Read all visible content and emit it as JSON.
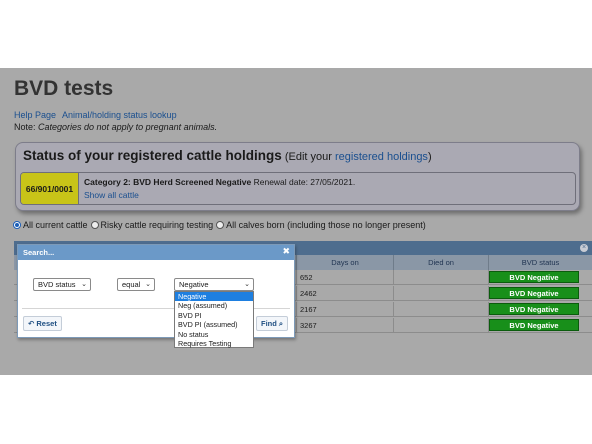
{
  "page": {
    "title": "BVD tests",
    "links": [
      "Help Page",
      "Animal/holding status lookup"
    ],
    "note_prefix": "Note: ",
    "note_text": "Categories do not apply to pregnant animals."
  },
  "holdings": {
    "title": "Status of your registered cattle holdings",
    "edit_prefix": " (Edit your ",
    "edit_link": "registered holdings",
    "edit_suffix": ")",
    "holding_id": "66/901/0001",
    "category": "Category 2: BVD Herd Screened Negative",
    "renewal": " Renewal date: 27/05/2021.",
    "show_all": "Show all cattle"
  },
  "filters": [
    {
      "label": "All current cattle",
      "selected": true
    },
    {
      "label": "Risky cattle requiring testing",
      "selected": false
    },
    {
      "label": "All calves born (including those no longer present)",
      "selected": false
    }
  ],
  "grid": {
    "close_icon": "×",
    "columns": {
      "days_on": "Days on",
      "died_on": "Died on",
      "bvd_status": "BVD status"
    },
    "rows": [
      {
        "days": "652",
        "died": "",
        "status": "BVD Negative"
      },
      {
        "days": "2462",
        "died": "",
        "status": "BVD Negative"
      },
      {
        "days": "2167",
        "died": "",
        "status": "BVD Negative"
      },
      {
        "days": "3267",
        "died": "",
        "status": "BVD Negative"
      }
    ]
  },
  "search": {
    "title": "Search...",
    "close_icon": "✖",
    "field": "BVD status",
    "operator": "equal",
    "value": "Negative",
    "reset_icon": "↶",
    "reset_label": "Reset",
    "find_label": "Find",
    "find_icon": "⌕",
    "options": [
      "Negative",
      "Neg (assumed)",
      "BVD PI",
      "BVD PI (assumed)",
      "No status",
      "Requires Testing"
    ],
    "selected_option": 0
  },
  "colors": {
    "badge_green": "#188f1a",
    "dialog_title_blue": "#6b99c8",
    "holding_yellow": "#c8c418",
    "link_blue": "#1a4f8f",
    "overlay_gray": "#a9a9a9"
  }
}
